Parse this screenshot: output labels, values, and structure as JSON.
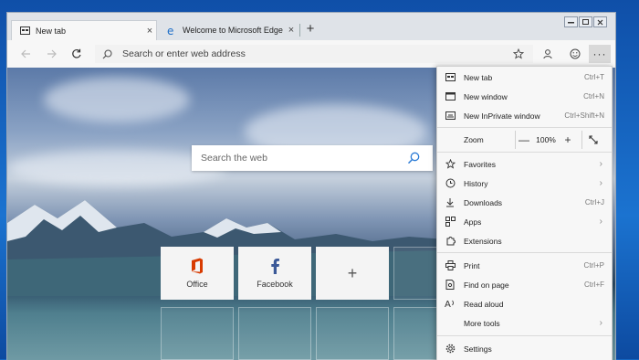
{
  "browser": {
    "tabs": [
      {
        "label": "New tab",
        "close": "×"
      },
      {
        "label": "Welcome to Microsoft Edge Can",
        "close": "×"
      }
    ],
    "new_tab_symbol": "+",
    "address_placeholder": "Search or enter web address",
    "more_symbol": "···"
  },
  "page": {
    "search_placeholder": "Search the web",
    "tiles": [
      {
        "label": "Office"
      },
      {
        "label": "Facebook"
      },
      {
        "label": "+"
      }
    ]
  },
  "menu": {
    "items_top": [
      {
        "label": "New tab",
        "shortcut": "Ctrl+T"
      },
      {
        "label": "New window",
        "shortcut": "Ctrl+N"
      },
      {
        "label": "New InPrivate window",
        "shortcut": "Ctrl+Shift+N"
      }
    ],
    "zoom": {
      "label": "Zoom",
      "minus": "—",
      "value": "100%",
      "plus": "+"
    },
    "items_mid": [
      {
        "label": "Favorites",
        "arrow": "›"
      },
      {
        "label": "History",
        "arrow": "›"
      },
      {
        "label": "Downloads",
        "shortcut": "Ctrl+J"
      },
      {
        "label": "Apps",
        "arrow": "›"
      },
      {
        "label": "Extensions"
      }
    ],
    "items_low": [
      {
        "label": "Print",
        "shortcut": "Ctrl+P"
      },
      {
        "label": "Find on page",
        "shortcut": "Ctrl+F"
      },
      {
        "label": "Read aloud"
      },
      {
        "label": "More tools",
        "arrow": "›"
      }
    ],
    "settings": {
      "label": "Settings"
    }
  },
  "colors": {
    "office_orange": "#d83b01",
    "facebook_blue": "#3b5998",
    "edge_blue": "#1e6fc8",
    "search_blue": "#2b7bd6"
  }
}
